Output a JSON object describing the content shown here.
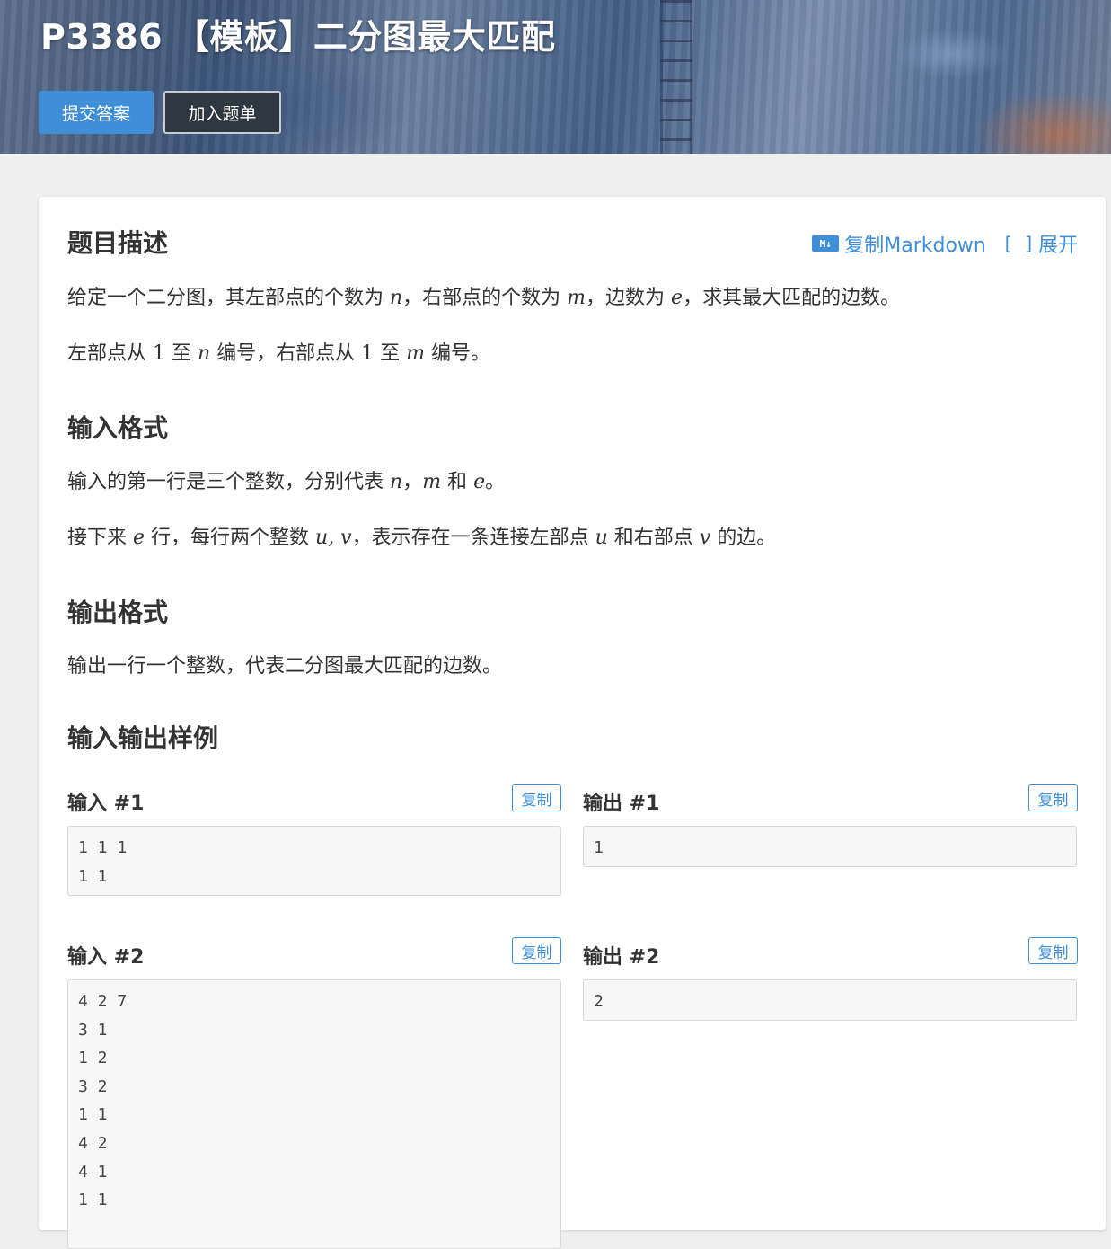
{
  "header": {
    "title": "P3386 【模板】二分图最大匹配",
    "submit_button": "提交答案",
    "add_button": "加入题单"
  },
  "tools": {
    "md_icon_text": "M↓",
    "copy_markdown": "复制Markdown",
    "expand_icon": "[ ]",
    "expand": "展开"
  },
  "description": {
    "title": "题目描述",
    "para1": {
      "t1": "给定一个二分图，其左部点的个数为 ",
      "n": "n",
      "t2": "，右部点的个数为 ",
      "m": "m",
      "t3": "，边数为 ",
      "e": "e",
      "t4": "，求其最大匹配的边数。"
    },
    "para2": {
      "t1": "左部点从 ",
      "one1": "1",
      "t2": " 至 ",
      "n": "n",
      "t3": " 编号，右部点从 ",
      "one2": "1",
      "t4": " 至 ",
      "m": "m",
      "t5": " 编号。"
    }
  },
  "input_format": {
    "title": "输入格式",
    "para1": {
      "t1": "输入的第一行是三个整数，分别代表 ",
      "n": "n",
      "t2": "，",
      "m": "m",
      "t3": " 和 ",
      "e": "e",
      "t4": "。"
    },
    "para2": {
      "t1": "接下来 ",
      "e": "e",
      "t2": " 行，每行两个整数 ",
      "uv": "u, v",
      "t3": "，表示存在一条连接左部点 ",
      "u": "u",
      "t4": " 和右部点 ",
      "v": "v",
      "t5": " 的边。"
    }
  },
  "output_format": {
    "title": "输出格式",
    "para1": "输出一行一个整数，代表二分图最大匹配的边数。"
  },
  "samples": {
    "title": "输入输出样例",
    "copy_label": "复制",
    "items": [
      {
        "input_label": "输入 #1",
        "output_label": "输出 #1",
        "input_lines": [
          "1 1 1",
          "1 1"
        ],
        "output_lines": [
          "1"
        ]
      },
      {
        "input_label": "输入 #2",
        "output_label": "输出 #2",
        "input_lines": [
          "4 2 7",
          "3 1",
          "1 2",
          "3 2",
          "1 1",
          "4 2",
          "4 1",
          "1 1"
        ],
        "output_lines": [
          "2"
        ]
      }
    ]
  }
}
